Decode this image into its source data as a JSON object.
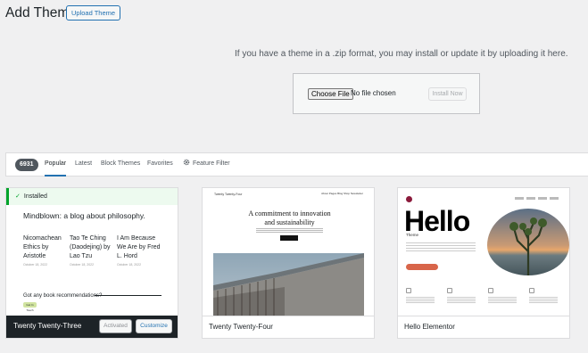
{
  "header": {
    "title": "Add Themes",
    "upload_button": "Upload Theme"
  },
  "upload": {
    "message": "If you have a theme in a .zip format, you may install or update it by uploading it here.",
    "choose_file": "Choose File",
    "no_file": "No file chosen",
    "install_now": "Install Now"
  },
  "filter": {
    "count": "6931",
    "tabs": [
      "Popular",
      "Latest",
      "Block Themes",
      "Favorites"
    ],
    "feature_filter": "Feature Filter",
    "current_tab": "Popular"
  },
  "themes": [
    {
      "name": "Twenty Twenty-Three",
      "installed_notice": "Installed",
      "preview": {
        "title": "Mindblown: a blog about philosophy.",
        "books": [
          {
            "title": "Nicomachean Ethics by Aristotle",
            "date": "October 18, 2022"
          },
          {
            "title": "Tao Te Ching (Daodejing) by Lao Tzu",
            "date": "October 18, 2022"
          },
          {
            "title": "I Am Because We Are by Fred L. Hord",
            "date": "October 18, 2022"
          }
        ],
        "question": "Got any book recommendations?",
        "pill": "Get In Touch"
      },
      "activated_label": "Activated",
      "customize_label": "Customize"
    },
    {
      "name": "Twenty Twenty-Four",
      "preview": {
        "logo": "Twenty Twenty-Four",
        "nav": "About  Pages  Blog  Shop  Newsletter",
        "headline": "A commitment to innovation and sustainability"
      }
    },
    {
      "name": "Hello Elementor",
      "preview": {
        "big": "Hello",
        "theme": "Theme"
      }
    }
  ],
  "colors": {
    "accent": "#2271b1",
    "installed_green": "#00a32a",
    "dark_footer": "#1d2327"
  }
}
